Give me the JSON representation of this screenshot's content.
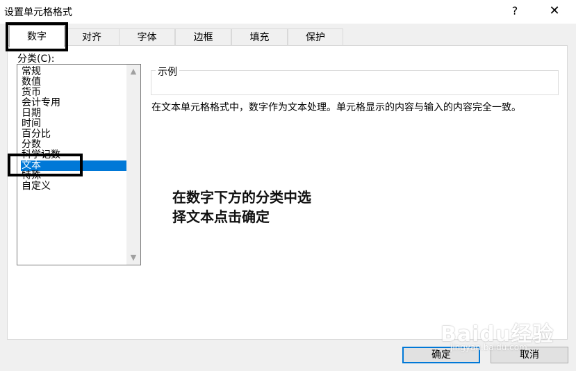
{
  "window": {
    "title": "设置单元格格式",
    "help_symbol": "?",
    "close_symbol": "✕"
  },
  "tabs": [
    {
      "label": "数字"
    },
    {
      "label": "对齐"
    },
    {
      "label": "字体"
    },
    {
      "label": "边框"
    },
    {
      "label": "填充"
    },
    {
      "label": "保护"
    }
  ],
  "category": {
    "label": "分类(C):",
    "items": [
      "常规",
      "数值",
      "货币",
      "会计专用",
      "日期",
      "时间",
      "百分比",
      "分数",
      "科学记数",
      "文本",
      "特殊",
      "自定义"
    ],
    "selected": "文本"
  },
  "sample": {
    "label": "示例",
    "value": ""
  },
  "description": "在文本单元格格式中，数字作为文本处理。单元格显示的内容与输入的内容完全一致。",
  "annotation": [
    "在数字下方的分类中选",
    "择文本点击确定"
  ],
  "buttons": {
    "ok": "确定",
    "cancel": "取消"
  },
  "watermark": {
    "main": "Baidu经验",
    "sub": "jingyan.baidu.com"
  }
}
